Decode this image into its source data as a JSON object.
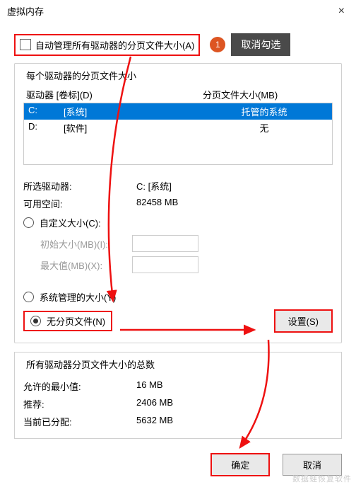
{
  "window": {
    "title": "虚拟内存"
  },
  "auto_manage": {
    "label": "自动管理所有驱动器的分页文件大小(A)",
    "tip": "取消勾选",
    "badge": "1"
  },
  "per_drive": {
    "title": "每个驱动器的分页文件大小",
    "col_drive": "驱动器 [卷标](D)",
    "col_size": "分页文件大小(MB)",
    "rows": [
      {
        "letter": "C:",
        "label": "[系统]",
        "size": "托管的系统",
        "selected": true
      },
      {
        "letter": "D:",
        "label": "[软件]",
        "size": "无",
        "selected": false
      }
    ],
    "selected_label": "所选驱动器:",
    "selected_value": "C:  [系统]",
    "space_label": "可用空间:",
    "space_value": "82458 MB",
    "custom": "自定义大小(C):",
    "initial": "初始大小(MB)(I):",
    "max": "最大值(MB)(X):",
    "system": "系统管理的大小(Y)",
    "none": "无分页文件(N)",
    "set_btn": "设置(S)"
  },
  "totals": {
    "title": "所有驱动器分页文件大小的总数",
    "min_label": "允许的最小值:",
    "min_value": "16 MB",
    "rec_label": "推荐:",
    "rec_value": "2406 MB",
    "cur_label": "当前已分配:",
    "cur_value": "5632 MB"
  },
  "buttons": {
    "ok": "确定",
    "cancel": "取消"
  },
  "watermark": "数据蛙恢复软件"
}
